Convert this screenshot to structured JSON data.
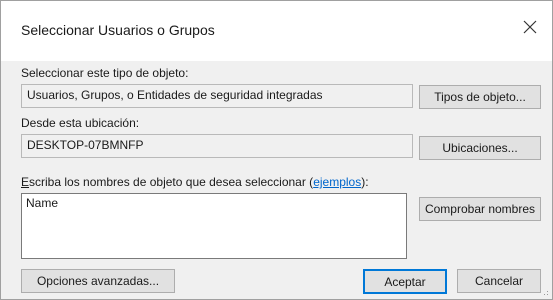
{
  "window": {
    "title": "Seleccionar Usuarios o Grupos"
  },
  "object_type": {
    "label": "Seleccionar este tipo de objeto:",
    "value": "Usuarios, Grupos, o Entidades de seguridad integradas",
    "button": "Tipos de objeto..."
  },
  "location": {
    "label": "Desde esta ubicación:",
    "value": "DESKTOP-07BMNFP",
    "button": "Ubicaciones..."
  },
  "names": {
    "label_first": "E",
    "label_rest": "scriba los nombres de objeto que desea seleccionar (",
    "examples_link": "ejemplos",
    "label_end": "):",
    "value": "Name",
    "check_button": "Comprobar nombres"
  },
  "footer": {
    "advanced_button": "Opciones avanzadas...",
    "ok_button": "Aceptar",
    "cancel_button": "Cancelar"
  }
}
